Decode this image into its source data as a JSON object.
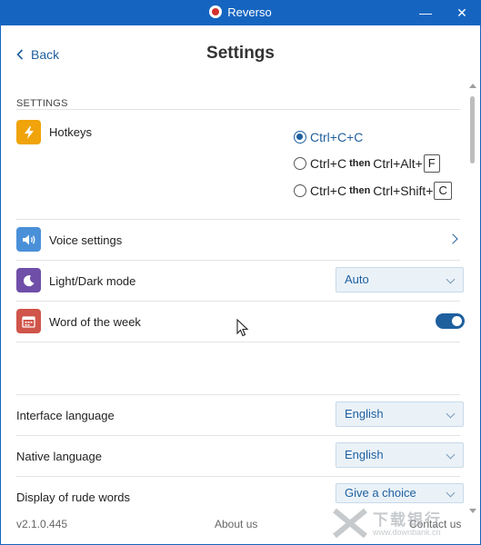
{
  "window": {
    "title": "Reverso",
    "minimize_glyph": "—",
    "close_glyph": "✕"
  },
  "header": {
    "back_label": "Back",
    "page_title": "Settings"
  },
  "section": {
    "label": "SETTINGS"
  },
  "hotkeys": {
    "label": "Hotkeys",
    "icon": "lightning-icon",
    "options": [
      {
        "selected": true,
        "prefix": "Ctrl+C+C",
        "then": "",
        "suffix": "",
        "key": ""
      },
      {
        "selected": false,
        "prefix": "Ctrl+C",
        "then": "then",
        "suffix": "Ctrl+Alt+",
        "key": "F"
      },
      {
        "selected": false,
        "prefix": "Ctrl+C",
        "then": "then",
        "suffix": "Ctrl+Shift+",
        "key": "C"
      }
    ]
  },
  "voice": {
    "label": "Voice settings",
    "icon": "speaker-icon"
  },
  "theme": {
    "label": "Light/Dark mode",
    "icon": "moon-icon",
    "value": "Auto"
  },
  "word_of_week": {
    "label": "Word of the week",
    "icon": "calendar-icon",
    "enabled": true
  },
  "languages": {
    "interface_label": "Interface language",
    "interface_value": "English",
    "native_label": "Native language",
    "native_value": "English",
    "rude_label": "Display of rude words",
    "rude_value": "Give a choice"
  },
  "footer": {
    "version": "v2.1.0.445",
    "about": "About us",
    "contact": "Contact us"
  },
  "watermark": {
    "brand": "下载银行",
    "url": "www.downbank.cn"
  },
  "colors": {
    "titlebar": "#1565c0",
    "accent": "#1f5f9e",
    "hotkeys_icon": "#f0a30a",
    "voice_icon": "#4a90d9",
    "theme_icon": "#6f4fa8",
    "calendar_icon": "#d0554a"
  }
}
